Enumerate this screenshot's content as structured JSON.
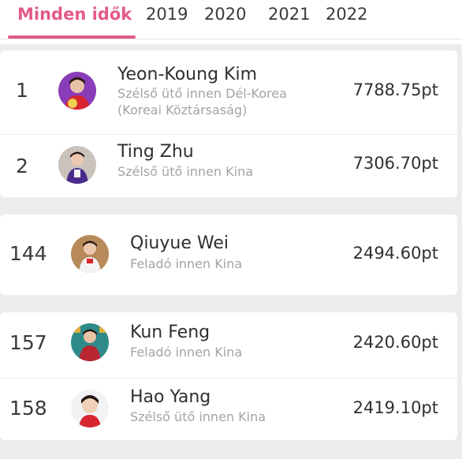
{
  "tabs": [
    {
      "label": "Minden idők",
      "active": true
    },
    {
      "label": "2019",
      "active": false
    },
    {
      "label": "2020",
      "active": false
    },
    {
      "label": "2021",
      "active": false
    },
    {
      "label": "2022",
      "active": false
    }
  ],
  "colors": {
    "accent": "#e25a8a",
    "text_primary": "#2f2f33",
    "text_secondary": "#a3a3a8",
    "background": "#ececee",
    "card": "#ffffff"
  },
  "players": [
    {
      "rank": "1",
      "name": "Yeon-Koung Kim",
      "position_line1": "Szélső ütő innen Dél-Korea",
      "position_line2": "(Koreai Köztársaság)",
      "points": "7788.75pt",
      "avatar_icon": "player-photo-icon"
    },
    {
      "rank": "2",
      "name": "Ting Zhu",
      "position_line1": "Szélső ütő innen Kina",
      "points": "7306.70pt",
      "avatar_icon": "player-photo-icon"
    },
    {
      "rank": "144",
      "name": "Qiuyue Wei",
      "position_line1": "Feladó innen Kina",
      "points": "2494.60pt",
      "avatar_icon": "player-photo-icon"
    },
    {
      "rank": "157",
      "name": "Kun Feng",
      "position_line1": "Feladó innen Kina",
      "points": "2420.60pt",
      "avatar_icon": "player-photo-icon"
    },
    {
      "rank": "158",
      "name": "Hao Yang",
      "position_line1": "Szélső ütő innen Kina",
      "points": "2419.10pt",
      "avatar_icon": "player-photo-icon"
    }
  ]
}
